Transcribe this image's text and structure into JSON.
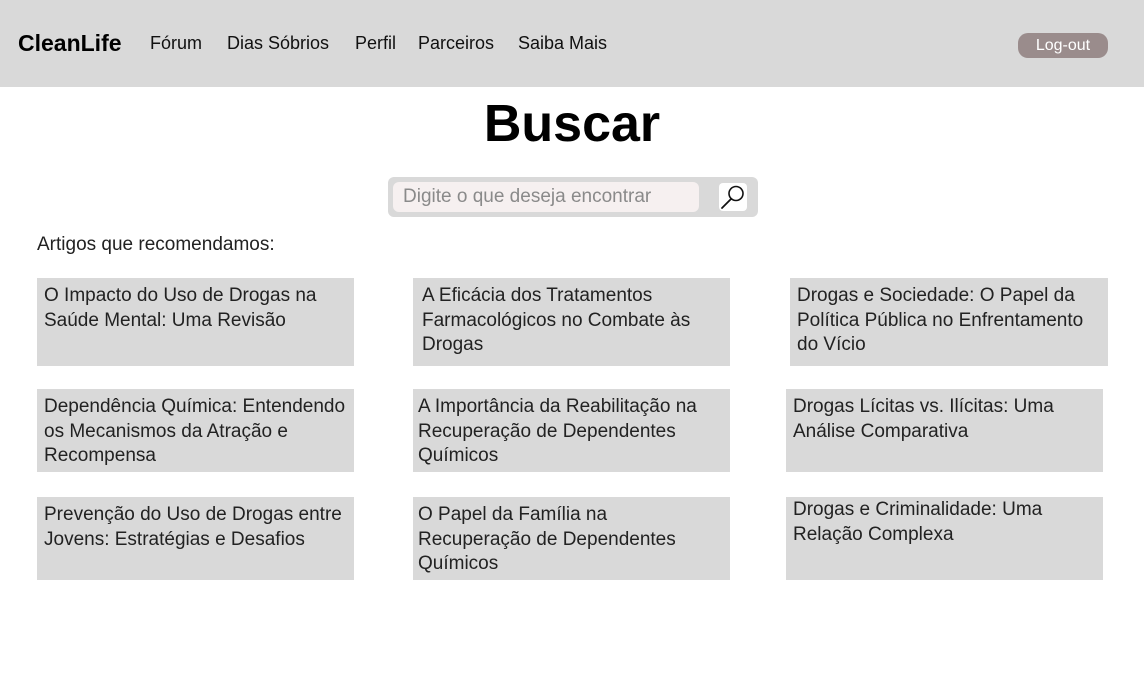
{
  "nav": {
    "brand": "CleanLife",
    "items": [
      "Fórum",
      "Dias Sóbrios",
      "Perfil",
      "Parceiros",
      "Saiba Mais"
    ],
    "logout_label": "Log-out",
    "background_color": "#d9d9d9",
    "logout_color": "#9a8c8c"
  },
  "page": {
    "title": "Buscar"
  },
  "search": {
    "placeholder": "Digite o que deseja encontrar",
    "value": "",
    "icon": "search-icon"
  },
  "articles": {
    "section_label": "Artigos que recomendamos:",
    "items": [
      "O Impacto do Uso de Drogas na Saúde Mental: Uma Revisão",
      "A Eficácia dos Tratamentos Farmacológicos no Combate às Drogas",
      "Drogas e Sociedade: O Papel da Política Pública no Enfrentamento do Vício",
      "Dependência Química: Entendendo os Mecanismos da Atração e Recompensa",
      "A Importância da Reabilitação na Recuperação de Dependentes Químicos",
      "Drogas Lícitas vs. Ilícitas: Uma Análise Comparativa",
      "Prevenção do Uso de Drogas entre Jovens: Estratégias e Desafios",
      "O Papel da Família na Recuperação de Dependentes Químicos",
      "Drogas e Criminalidade: Uma Relação Complexa"
    ]
  }
}
